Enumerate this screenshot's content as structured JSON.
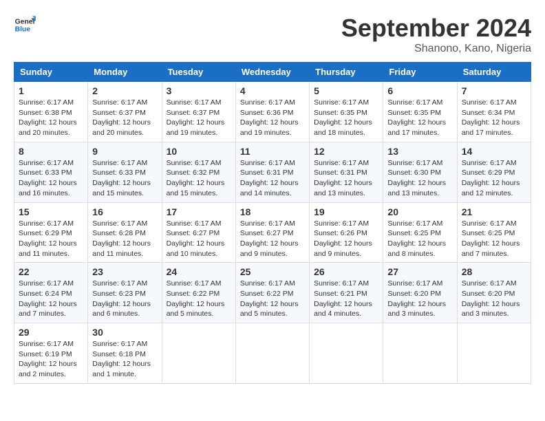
{
  "header": {
    "logo_line1": "General",
    "logo_line2": "Blue",
    "month": "September 2024",
    "location": "Shanono, Kano, Nigeria"
  },
  "days_of_week": [
    "Sunday",
    "Monday",
    "Tuesday",
    "Wednesday",
    "Thursday",
    "Friday",
    "Saturday"
  ],
  "weeks": [
    [
      {
        "day": "1",
        "info": "Sunrise: 6:17 AM\nSunset: 6:38 PM\nDaylight: 12 hours\nand 20 minutes."
      },
      {
        "day": "2",
        "info": "Sunrise: 6:17 AM\nSunset: 6:37 PM\nDaylight: 12 hours\nand 20 minutes."
      },
      {
        "day": "3",
        "info": "Sunrise: 6:17 AM\nSunset: 6:37 PM\nDaylight: 12 hours\nand 19 minutes."
      },
      {
        "day": "4",
        "info": "Sunrise: 6:17 AM\nSunset: 6:36 PM\nDaylight: 12 hours\nand 19 minutes."
      },
      {
        "day": "5",
        "info": "Sunrise: 6:17 AM\nSunset: 6:35 PM\nDaylight: 12 hours\nand 18 minutes."
      },
      {
        "day": "6",
        "info": "Sunrise: 6:17 AM\nSunset: 6:35 PM\nDaylight: 12 hours\nand 17 minutes."
      },
      {
        "day": "7",
        "info": "Sunrise: 6:17 AM\nSunset: 6:34 PM\nDaylight: 12 hours\nand 17 minutes."
      }
    ],
    [
      {
        "day": "8",
        "info": "Sunrise: 6:17 AM\nSunset: 6:33 PM\nDaylight: 12 hours\nand 16 minutes."
      },
      {
        "day": "9",
        "info": "Sunrise: 6:17 AM\nSunset: 6:33 PM\nDaylight: 12 hours\nand 15 minutes."
      },
      {
        "day": "10",
        "info": "Sunrise: 6:17 AM\nSunset: 6:32 PM\nDaylight: 12 hours\nand 15 minutes."
      },
      {
        "day": "11",
        "info": "Sunrise: 6:17 AM\nSunset: 6:31 PM\nDaylight: 12 hours\nand 14 minutes."
      },
      {
        "day": "12",
        "info": "Sunrise: 6:17 AM\nSunset: 6:31 PM\nDaylight: 12 hours\nand 13 minutes."
      },
      {
        "day": "13",
        "info": "Sunrise: 6:17 AM\nSunset: 6:30 PM\nDaylight: 12 hours\nand 13 minutes."
      },
      {
        "day": "14",
        "info": "Sunrise: 6:17 AM\nSunset: 6:29 PM\nDaylight: 12 hours\nand 12 minutes."
      }
    ],
    [
      {
        "day": "15",
        "info": "Sunrise: 6:17 AM\nSunset: 6:29 PM\nDaylight: 12 hours\nand 11 minutes."
      },
      {
        "day": "16",
        "info": "Sunrise: 6:17 AM\nSunset: 6:28 PM\nDaylight: 12 hours\nand 11 minutes."
      },
      {
        "day": "17",
        "info": "Sunrise: 6:17 AM\nSunset: 6:27 PM\nDaylight: 12 hours\nand 10 minutes."
      },
      {
        "day": "18",
        "info": "Sunrise: 6:17 AM\nSunset: 6:27 PM\nDaylight: 12 hours\nand 9 minutes."
      },
      {
        "day": "19",
        "info": "Sunrise: 6:17 AM\nSunset: 6:26 PM\nDaylight: 12 hours\nand 9 minutes."
      },
      {
        "day": "20",
        "info": "Sunrise: 6:17 AM\nSunset: 6:25 PM\nDaylight: 12 hours\nand 8 minutes."
      },
      {
        "day": "21",
        "info": "Sunrise: 6:17 AM\nSunset: 6:25 PM\nDaylight: 12 hours\nand 7 minutes."
      }
    ],
    [
      {
        "day": "22",
        "info": "Sunrise: 6:17 AM\nSunset: 6:24 PM\nDaylight: 12 hours\nand 7 minutes."
      },
      {
        "day": "23",
        "info": "Sunrise: 6:17 AM\nSunset: 6:23 PM\nDaylight: 12 hours\nand 6 minutes."
      },
      {
        "day": "24",
        "info": "Sunrise: 6:17 AM\nSunset: 6:22 PM\nDaylight: 12 hours\nand 5 minutes."
      },
      {
        "day": "25",
        "info": "Sunrise: 6:17 AM\nSunset: 6:22 PM\nDaylight: 12 hours\nand 5 minutes."
      },
      {
        "day": "26",
        "info": "Sunrise: 6:17 AM\nSunset: 6:21 PM\nDaylight: 12 hours\nand 4 minutes."
      },
      {
        "day": "27",
        "info": "Sunrise: 6:17 AM\nSunset: 6:20 PM\nDaylight: 12 hours\nand 3 minutes."
      },
      {
        "day": "28",
        "info": "Sunrise: 6:17 AM\nSunset: 6:20 PM\nDaylight: 12 hours\nand 3 minutes."
      }
    ],
    [
      {
        "day": "29",
        "info": "Sunrise: 6:17 AM\nSunset: 6:19 PM\nDaylight: 12 hours\nand 2 minutes."
      },
      {
        "day": "30",
        "info": "Sunrise: 6:17 AM\nSunset: 6:18 PM\nDaylight: 12 hours\nand 1 minute."
      },
      {
        "day": "",
        "info": ""
      },
      {
        "day": "",
        "info": ""
      },
      {
        "day": "",
        "info": ""
      },
      {
        "day": "",
        "info": ""
      },
      {
        "day": "",
        "info": ""
      }
    ]
  ]
}
